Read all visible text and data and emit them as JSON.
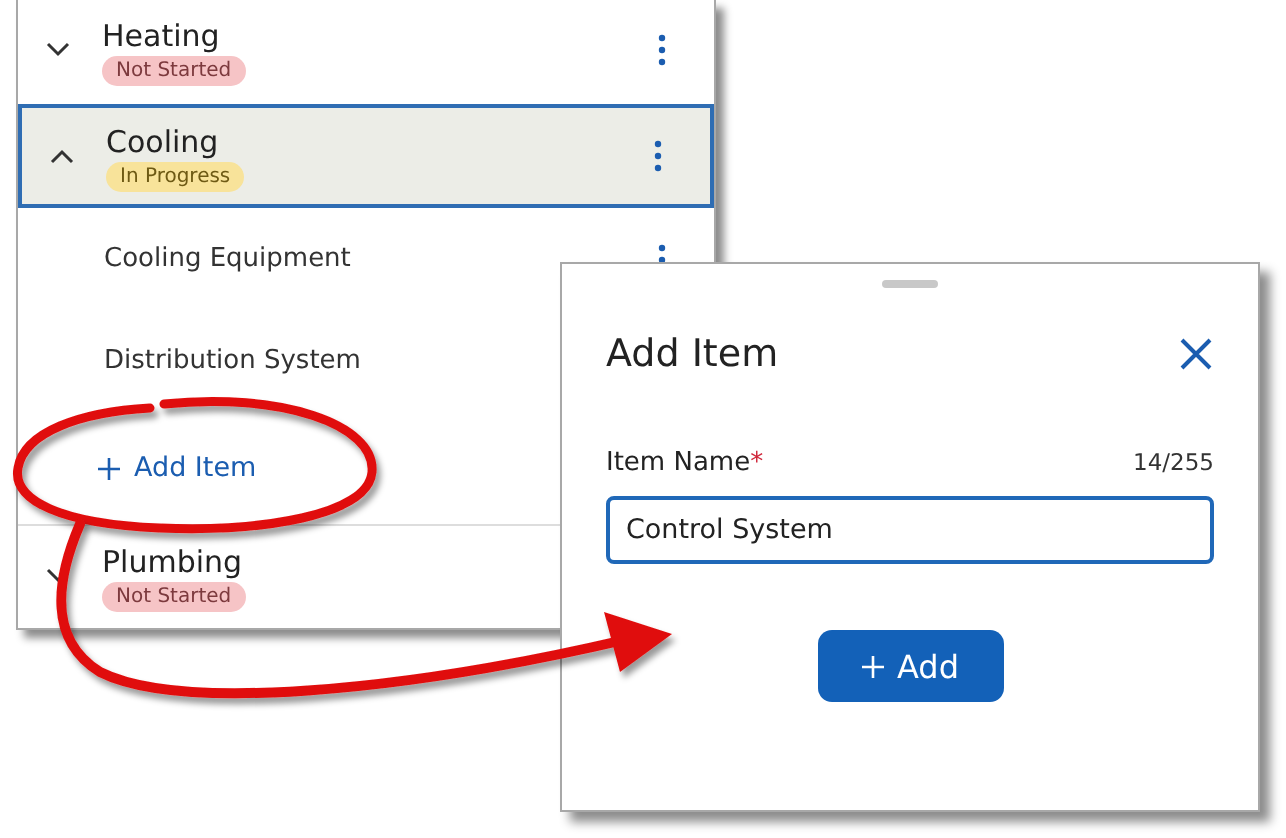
{
  "categories": [
    {
      "name": "Heating",
      "status": {
        "label": "Not Started",
        "kind": "not_started"
      },
      "expanded": false,
      "selected": false
    },
    {
      "name": "Cooling",
      "status": {
        "label": "In Progress",
        "kind": "in_progress"
      },
      "expanded": true,
      "selected": true,
      "items": [
        {
          "name": "Cooling Equipment"
        },
        {
          "name": "Distribution System"
        }
      ],
      "add_link": "Add Item"
    },
    {
      "name": "Plumbing",
      "status": {
        "label": "Not Started",
        "kind": "not_started"
      },
      "expanded": false,
      "selected": false
    }
  ],
  "dialog": {
    "title": "Add Item",
    "field": {
      "label": "Item Name",
      "required_mark": "*",
      "counter": "14/255",
      "value": "Control System"
    },
    "button": "Add"
  }
}
